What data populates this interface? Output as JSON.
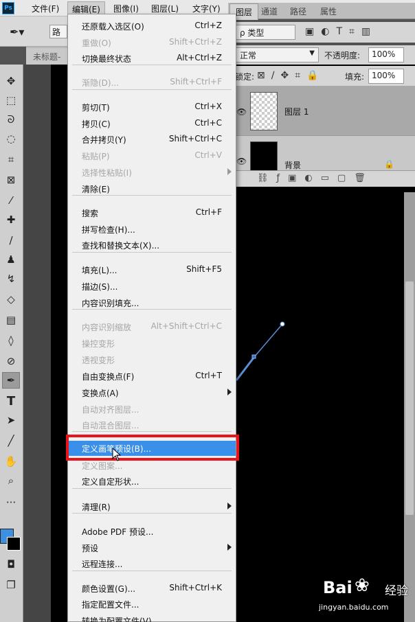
{
  "app": {
    "logo": "Ps"
  },
  "menubar": {
    "items": [
      "文件(F)",
      "编辑(E)",
      "图像(I)",
      "图层(L)",
      "文字(Y)"
    ]
  },
  "options": {
    "mode_label": "路"
  },
  "document": {
    "tab_label": "未标题-"
  },
  "panels": {
    "tabs": [
      "图层",
      "通道",
      "路径",
      "属性"
    ],
    "filter": {
      "label": "ρ 类型"
    },
    "blend": {
      "mode": "正常",
      "opacity_label": "不透明度:",
      "opacity": "100%"
    },
    "lock": {
      "label": "锁定:",
      "fill_label": "填充:",
      "fill": "100%"
    },
    "layers": [
      {
        "name": "图层 1",
        "selected": true
      },
      {
        "name": "背景",
        "selected": false
      }
    ]
  },
  "edit_menu": {
    "items": [
      {
        "label": "还原载入选区(O)",
        "shortcut": "Ctrl+Z",
        "disabled": false
      },
      {
        "label": "重做(O)",
        "shortcut": "Shift+Ctrl+Z",
        "disabled": true
      },
      {
        "label": "切换最终状态",
        "shortcut": "Alt+Ctrl+Z",
        "disabled": false
      },
      {
        "label": "渐隐(D)...",
        "shortcut": "Shift+Ctrl+F",
        "disabled": true
      },
      {
        "label": "剪切(T)",
        "shortcut": "Ctrl+X",
        "disabled": false
      },
      {
        "label": "拷贝(C)",
        "shortcut": "Ctrl+C",
        "disabled": false
      },
      {
        "label": "合并拷贝(Y)",
        "shortcut": "Shift+Ctrl+C",
        "disabled": false
      },
      {
        "label": "粘贴(P)",
        "shortcut": "Ctrl+V",
        "disabled": true
      },
      {
        "label": "选择性粘贴(I)",
        "shortcut": "",
        "disabled": true,
        "submenu": true
      },
      {
        "label": "清除(E)",
        "shortcut": "",
        "disabled": false
      },
      {
        "label": "搜索",
        "shortcut": "Ctrl+F",
        "disabled": false
      },
      {
        "label": "拼写检查(H)...",
        "shortcut": "",
        "disabled": false
      },
      {
        "label": "查找和替换文本(X)...",
        "shortcut": "",
        "disabled": false
      },
      {
        "label": "填充(L)...",
        "shortcut": "Shift+F5",
        "disabled": false
      },
      {
        "label": "描边(S)...",
        "shortcut": "",
        "disabled": false
      },
      {
        "label": "内容识别填充...",
        "shortcut": "",
        "disabled": false
      },
      {
        "label": "内容识别缩放",
        "shortcut": "Alt+Shift+Ctrl+C",
        "disabled": true
      },
      {
        "label": "操控变形",
        "shortcut": "",
        "disabled": true
      },
      {
        "label": "透视变形",
        "shortcut": "",
        "disabled": true
      },
      {
        "label": "自由变换点(F)",
        "shortcut": "Ctrl+T",
        "disabled": false
      },
      {
        "label": "变换点(A)",
        "shortcut": "",
        "disabled": false,
        "submenu": true
      },
      {
        "label": "自动对齐图层...",
        "shortcut": "",
        "disabled": true
      },
      {
        "label": "自动混合图层...",
        "shortcut": "",
        "disabled": true
      },
      {
        "label": "定义画笔预设(B)...",
        "shortcut": "",
        "disabled": false,
        "highlighted": true
      },
      {
        "label": "定义图案...",
        "shortcut": "",
        "disabled": true
      },
      {
        "label": "定义自定形状...",
        "shortcut": "",
        "disabled": false
      },
      {
        "label": "清理(R)",
        "shortcut": "",
        "disabled": false,
        "submenu": true
      },
      {
        "label": "Adobe PDF 预设...",
        "shortcut": "",
        "disabled": false
      },
      {
        "label": "预设",
        "shortcut": "",
        "disabled": false,
        "submenu": true
      },
      {
        "label": "远程连接...",
        "shortcut": "",
        "disabled": false
      },
      {
        "label": "颜色设置(G)...",
        "shortcut": "Shift+Ctrl+K",
        "disabled": false
      },
      {
        "label": "指定配置文件...",
        "shortcut": "",
        "disabled": false
      },
      {
        "label": "转换为配置文件(V)...",
        "shortcut": "",
        "disabled": false
      }
    ]
  },
  "colors": {
    "foreground": "#3d8fe0",
    "background": "#000000",
    "highlight": "#3a8fe8",
    "annotation": "#e8141c"
  },
  "watermark": {
    "brand": "Bai",
    "brand_suffix": "经验",
    "url": "jingyan.baidu.com"
  }
}
